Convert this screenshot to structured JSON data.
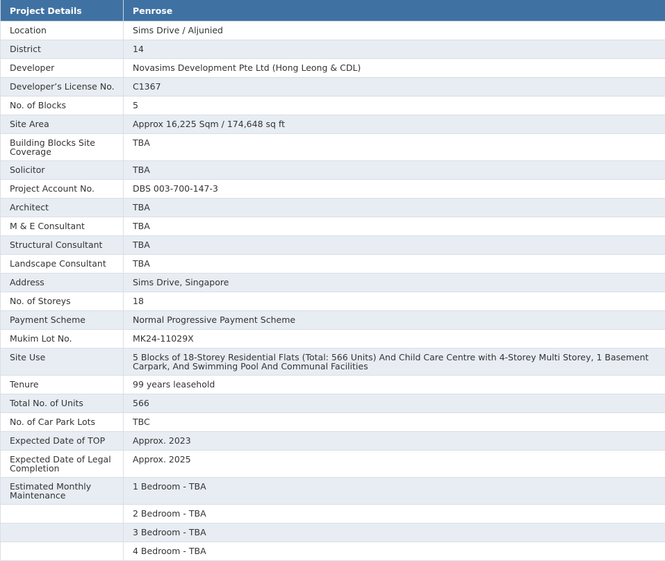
{
  "header": {
    "col1": "Project Details",
    "col2": "Penrose"
  },
  "rows": [
    {
      "label": "Location",
      "value": "Sims Drive / Aljunied"
    },
    {
      "label": "District",
      "value": "14"
    },
    {
      "label": "Developer",
      "value": "Novasims Development Pte Ltd (Hong Leong & CDL)"
    },
    {
      "label": "Developer’s License No.",
      "value": "C1367"
    },
    {
      "label": "No. of Blocks",
      "value": "5"
    },
    {
      "label": "Site Area",
      "value": "Approx 16,225 Sqm / 174,648 sq ft"
    },
    {
      "label": "Building Blocks Site Coverage",
      "value": "TBA"
    },
    {
      "label": "Solicitor",
      "value": "TBA"
    },
    {
      "label": "Project Account No.",
      "value": "DBS 003-700-147-3"
    },
    {
      "label": "Architect",
      "value": "TBA"
    },
    {
      "label": "M & E Consultant",
      "value": "TBA"
    },
    {
      "label": "Structural Consultant",
      "value": "TBA"
    },
    {
      "label": "Landscape Consultant",
      "value": "TBA"
    },
    {
      "label": "Address",
      "value": "Sims Drive, Singapore"
    },
    {
      "label": "No. of Storeys",
      "value": "18"
    },
    {
      "label": "Payment Scheme",
      "value": "Normal Progressive Payment Scheme"
    },
    {
      "label": "Mukim Lot No.",
      "value": "MK24-11029X"
    },
    {
      "label": "Site Use",
      "value": "5 Blocks of 18-Storey Residential Flats (Total: 566 Units) And Child Care Centre with 4-Storey Multi Storey, 1 Basement Carpark, And Swimming Pool And Communal Facilities"
    },
    {
      "label": "Tenure",
      "value": "99 years leasehold"
    },
    {
      "label": "Total No. of Units",
      "value": "566"
    },
    {
      "label": "No. of Car Park Lots",
      "value": "TBC"
    },
    {
      "label": "Expected Date of TOP",
      "value": "Approx. 2023"
    },
    {
      "label": "Expected Date of Legal Completion",
      "value": "Approx. 2025"
    },
    {
      "label": "Estimated Monthly Maintenance",
      "value": "1 Bedroom - TBA"
    },
    {
      "label": "",
      "value": "2 Bedroom - TBA"
    },
    {
      "label": "",
      "value": "3 Bedroom - TBA"
    },
    {
      "label": "",
      "value": "4 Bedroom - TBA"
    }
  ]
}
